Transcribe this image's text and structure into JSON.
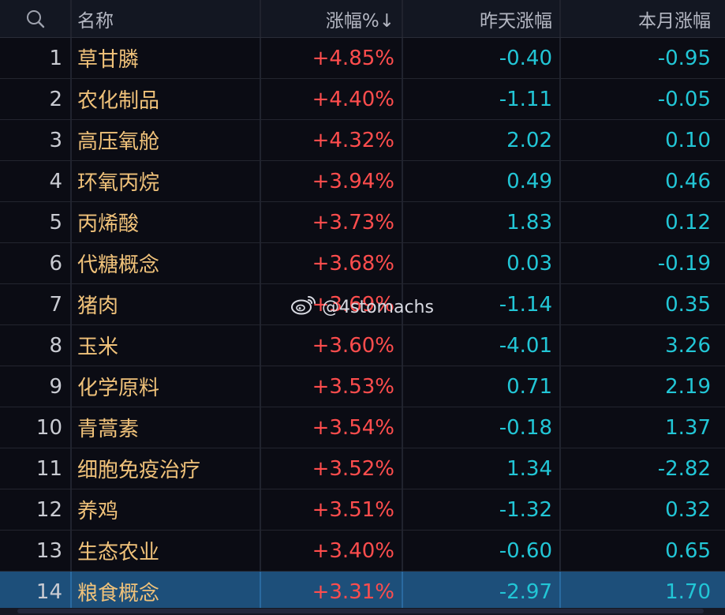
{
  "header": {
    "name": "名称",
    "change": "涨幅%↓",
    "yesterday": "昨天涨幅",
    "month": "本月涨幅"
  },
  "rows": [
    {
      "rank": "1",
      "name": "草甘膦",
      "change": "+4.85%",
      "yesterday": "-0.40",
      "month": "-0.95"
    },
    {
      "rank": "2",
      "name": "农化制品",
      "change": "+4.40%",
      "yesterday": "-1.11",
      "month": "-0.05"
    },
    {
      "rank": "3",
      "name": "高压氧舱",
      "change": "+4.32%",
      "yesterday": "2.02",
      "month": "0.10"
    },
    {
      "rank": "4",
      "name": "环氧丙烷",
      "change": "+3.94%",
      "yesterday": "0.49",
      "month": "0.46"
    },
    {
      "rank": "5",
      "name": "丙烯酸",
      "change": "+3.73%",
      "yesterday": "1.83",
      "month": "0.12"
    },
    {
      "rank": "6",
      "name": "代糖概念",
      "change": "+3.68%",
      "yesterday": "0.03",
      "month": "-0.19"
    },
    {
      "rank": "7",
      "name": "猪肉",
      "change": "+3.69%",
      "yesterday": "-1.14",
      "month": "0.35"
    },
    {
      "rank": "8",
      "name": "玉米",
      "change": "+3.60%",
      "yesterday": "-4.01",
      "month": "3.26"
    },
    {
      "rank": "9",
      "name": "化学原料",
      "change": "+3.53%",
      "yesterday": "0.71",
      "month": "2.19"
    },
    {
      "rank": "10",
      "name": "青蒿素",
      "change": "+3.54%",
      "yesterday": "-0.18",
      "month": "1.37"
    },
    {
      "rank": "11",
      "name": "细胞免疫治疗",
      "change": "+3.52%",
      "yesterday": "1.34",
      "month": "-2.82"
    },
    {
      "rank": "12",
      "name": "养鸡",
      "change": "+3.51%",
      "yesterday": "-1.32",
      "month": "0.32"
    },
    {
      "rank": "13",
      "name": "生态农业",
      "change": "+3.40%",
      "yesterday": "-0.60",
      "month": "0.65"
    },
    {
      "rank": "14",
      "name": "粮食概念",
      "change": "+3.31%",
      "yesterday": "-2.97",
      "month": "1.70"
    }
  ],
  "selected_row": 14,
  "watermark": "@4stomachs",
  "colors": {
    "up": "#ff4d4d",
    "down": "#22c6d6",
    "name": "#f0c27a",
    "selected": "#1d4f7a",
    "background": "#0b0c14"
  },
  "icons": {
    "search": "search-icon",
    "watermark": "weibo-icon"
  }
}
